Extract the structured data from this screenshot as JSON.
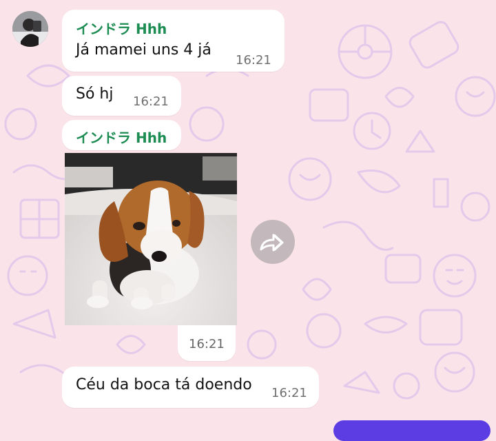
{
  "chat": {
    "messages": [
      {
        "sender": "インドラ Hhh",
        "text": "Já mamei uns 4 já",
        "time": "16:21"
      },
      {
        "text": "Só hj",
        "time": "16:21"
      },
      {
        "sender": "インドラ Hhh",
        "image": "beagle-puppy-photo",
        "time": "16:21"
      },
      {
        "text": "Céu da boca tá doendo",
        "time": "16:21"
      }
    ]
  },
  "colors": {
    "wallpaper": "#fbe3ea",
    "doodle": "#e3c9ea",
    "sender": "#1c8c52",
    "bubble": "#ffffff",
    "accent": "#5b3de3"
  },
  "icons": {
    "forward": "forward-icon",
    "avatar": "contact-avatar"
  }
}
